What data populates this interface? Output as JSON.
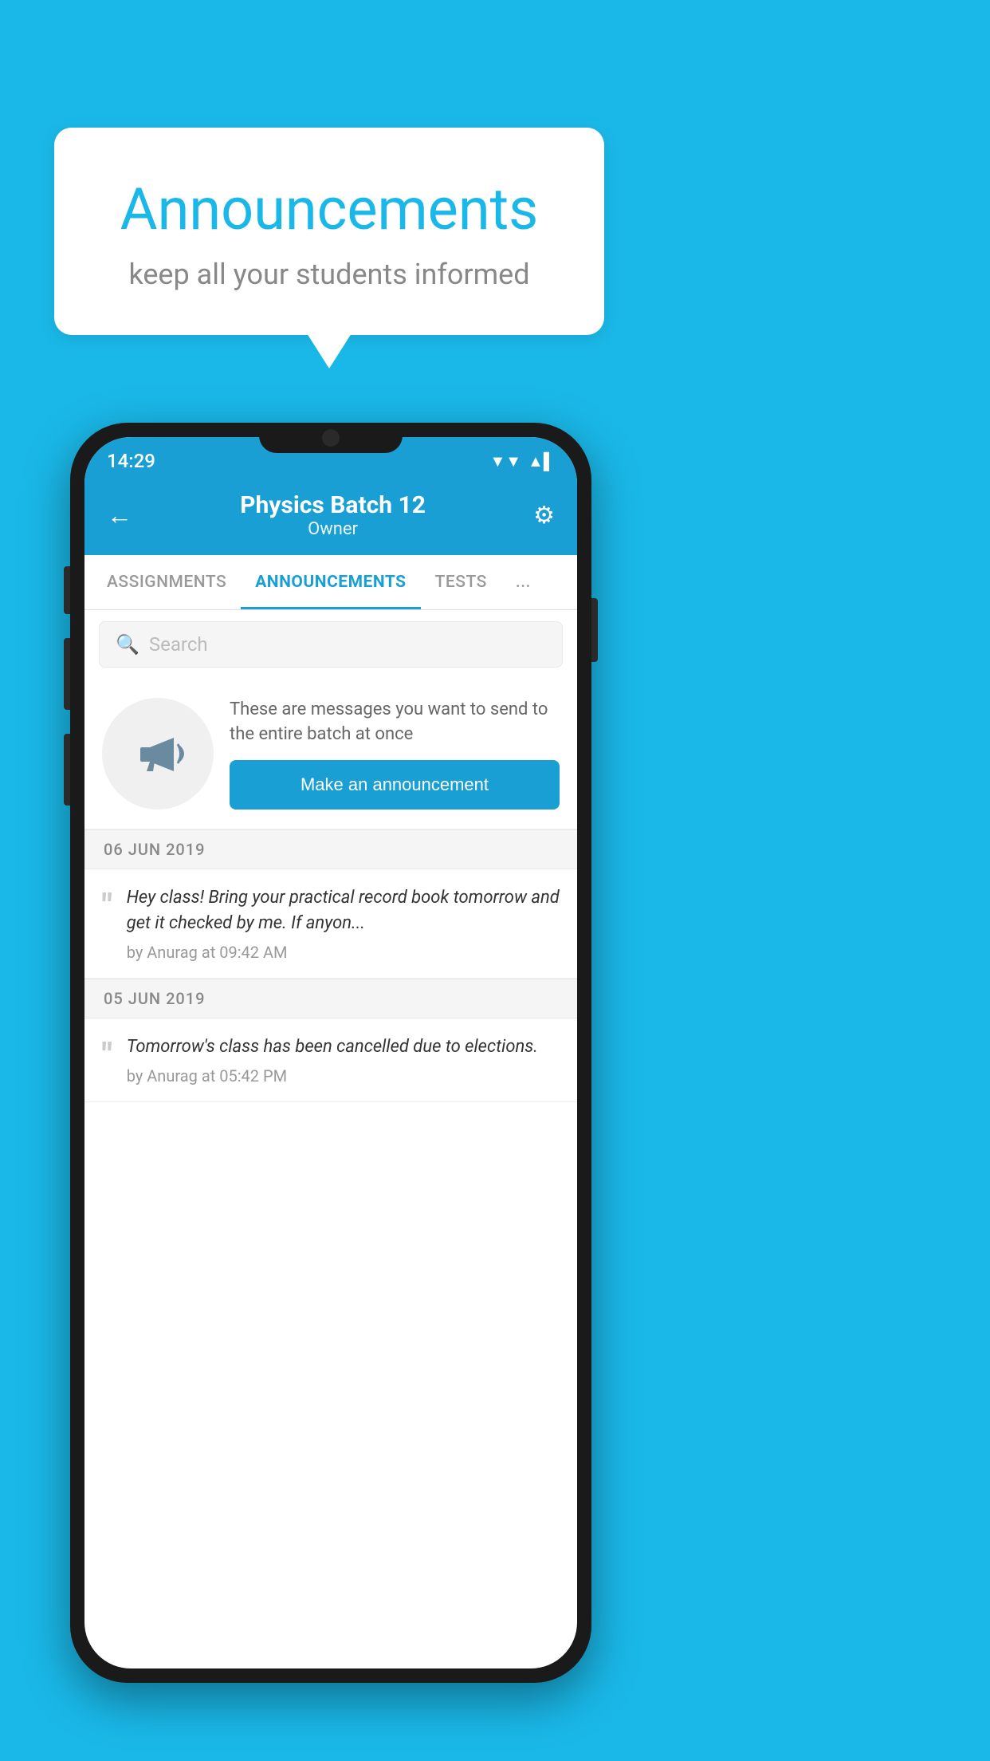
{
  "background_color": "#1ab8e8",
  "speech_bubble": {
    "title": "Announcements",
    "subtitle": "keep all your students informed"
  },
  "status_bar": {
    "time": "14:29",
    "wifi_icon": "▼",
    "signal_icon": "▲",
    "battery_icon": "▌"
  },
  "header": {
    "back_label": "←",
    "title": "Physics Batch 12",
    "subtitle": "Owner",
    "gear_icon": "⚙"
  },
  "tabs": [
    {
      "label": "ASSIGNMENTS",
      "active": false
    },
    {
      "label": "ANNOUNCEMENTS",
      "active": true
    },
    {
      "label": "TESTS",
      "active": false
    },
    {
      "label": "...",
      "active": false
    }
  ],
  "search": {
    "placeholder": "Search",
    "icon": "🔍"
  },
  "announcement_prompt": {
    "description_text": "These are messages you want to send to the entire batch at once",
    "button_label": "Make an announcement"
  },
  "date_sections": [
    {
      "date": "06  JUN  2019",
      "announcements": [
        {
          "text": "Hey class! Bring your practical record book tomorrow and get it checked by me. If anyon...",
          "meta": "by Anurag at 09:42 AM"
        }
      ]
    },
    {
      "date": "05  JUN  2019",
      "announcements": [
        {
          "text": "Tomorrow's class has been cancelled due to elections.",
          "meta": "by Anurag at 05:42 PM"
        }
      ]
    }
  ]
}
